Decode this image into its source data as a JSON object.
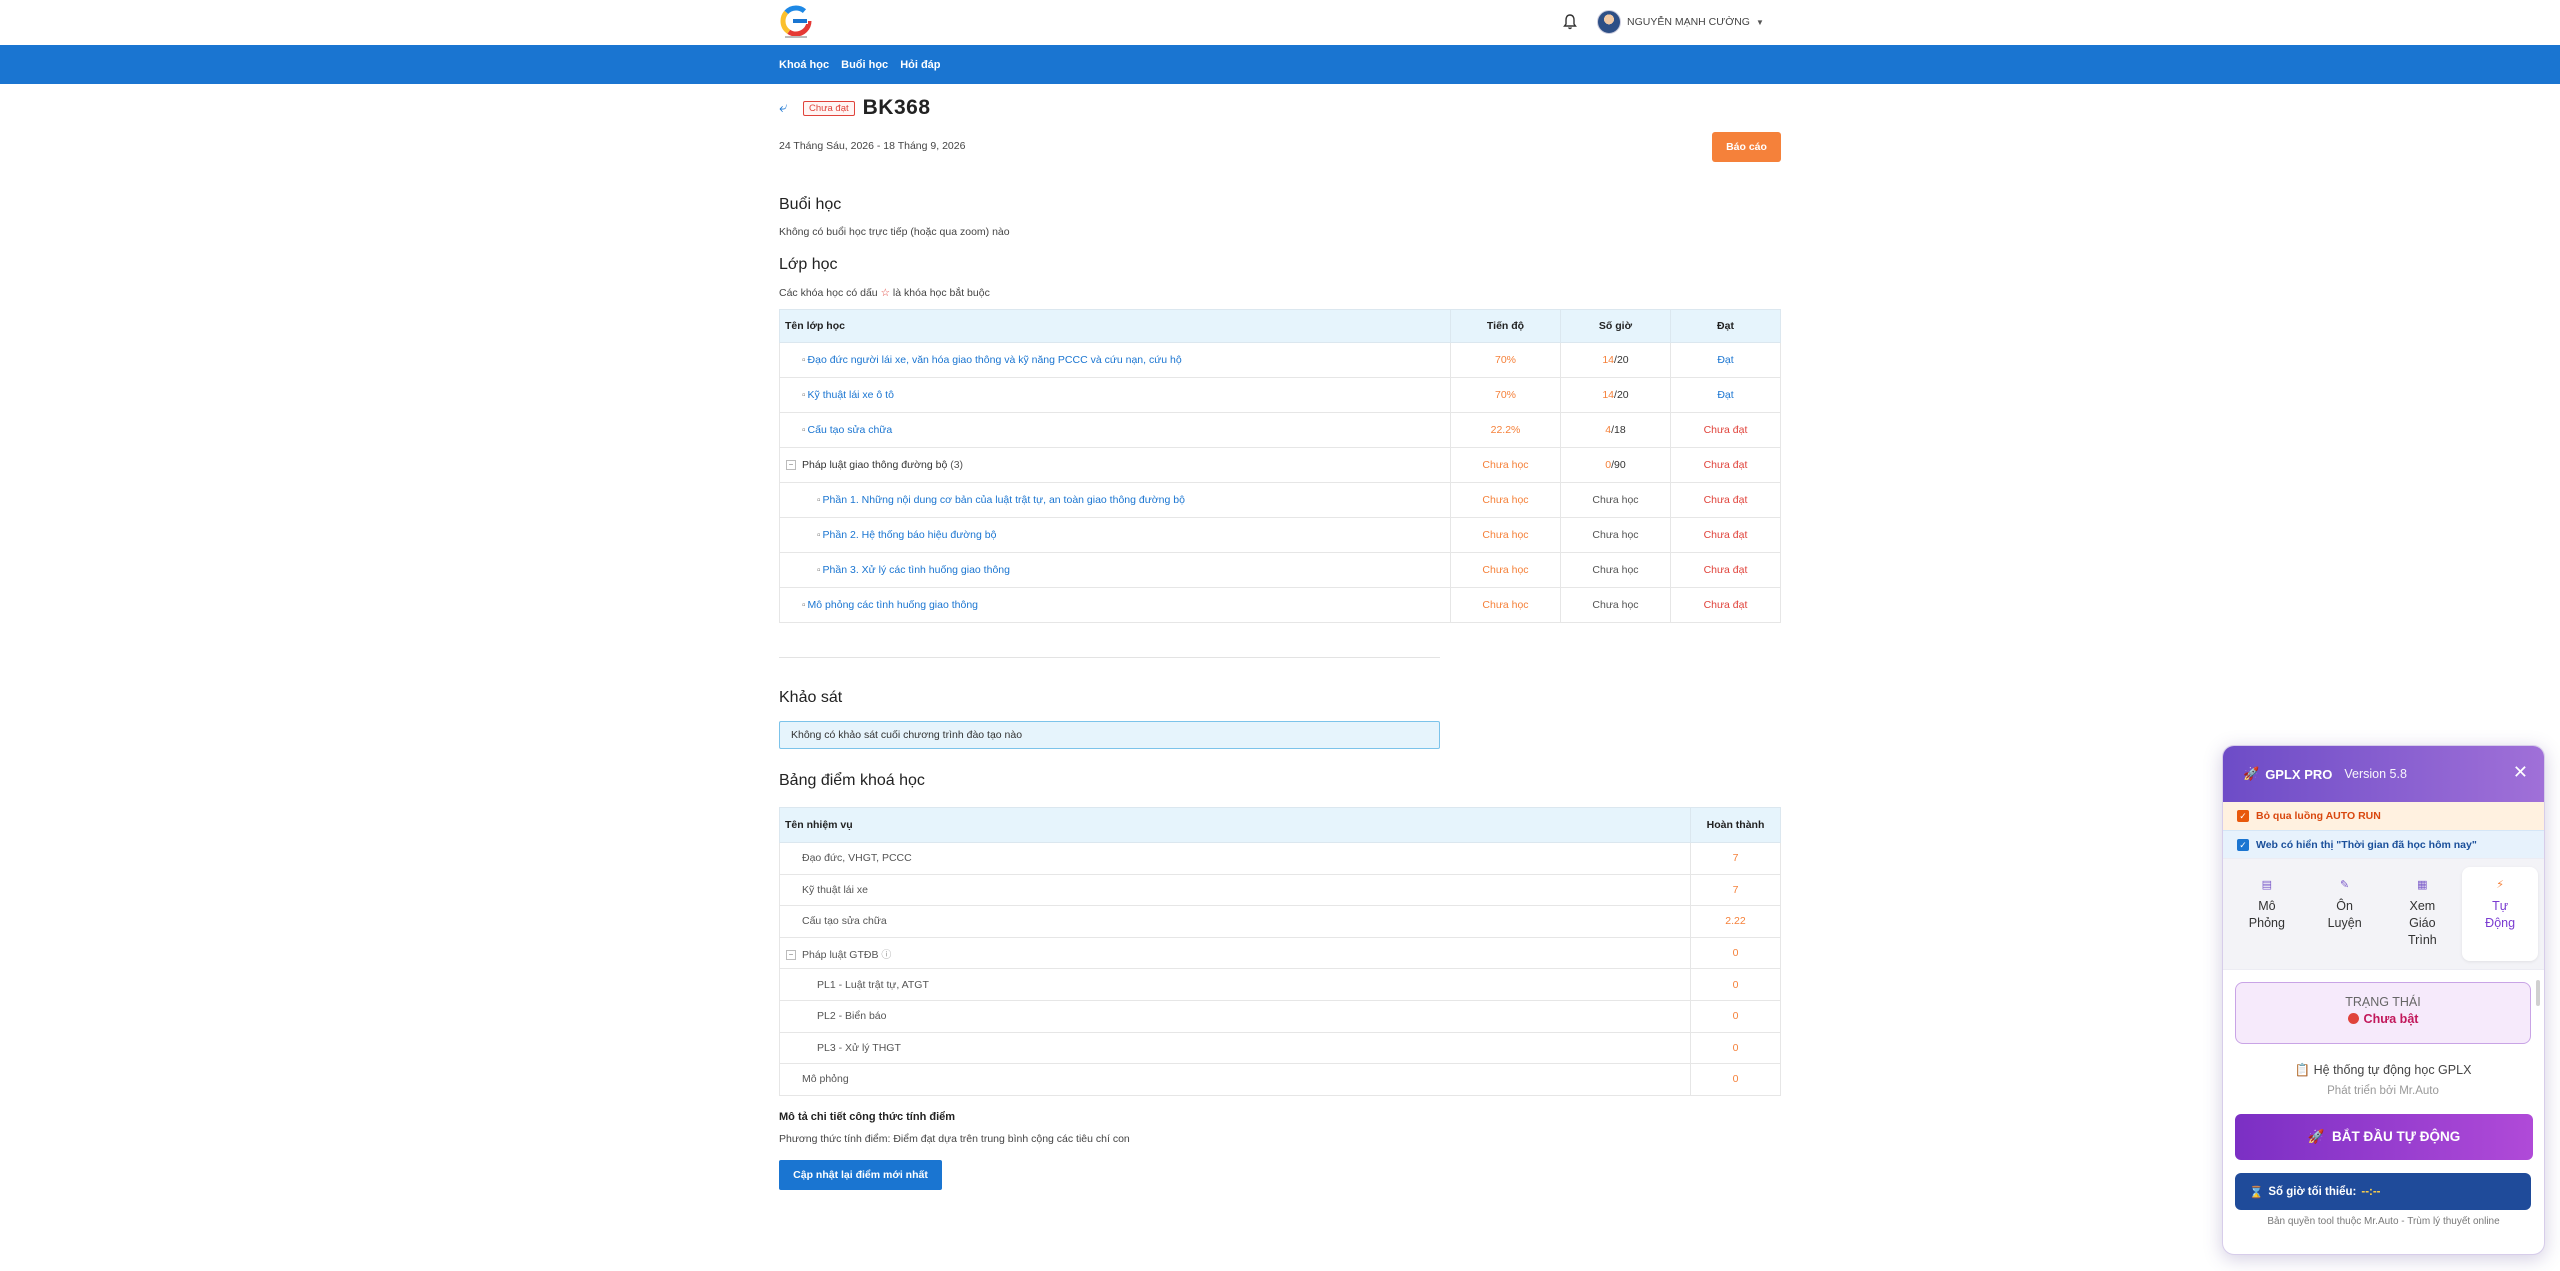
{
  "header": {
    "user_name": "NGUYỄN MẠNH CƯỜNG",
    "nav": [
      "Khoá học",
      "Buổi học",
      "Hỏi đáp"
    ]
  },
  "course": {
    "status_tag": "Chưa đạt",
    "title": "BK368",
    "date_range": "24 Tháng Sáu, 2026 - 18 Tháng 9, 2026",
    "report_label": "Báo cáo"
  },
  "sessions": {
    "heading": "Buổi học",
    "empty_text": "Không có buổi học trực tiếp (hoặc qua zoom) nào"
  },
  "classes": {
    "heading": "Lớp học",
    "note_before": "Các khóa học có dấu",
    "note_star": "☆",
    "note_after": "là khóa học bắt buộc",
    "columns": [
      "Tên lớp học",
      "Tiến độ",
      "Số giờ",
      "Đạt"
    ],
    "rows": [
      {
        "name": "Đạo đức người lái xe, văn hóa giao thông và kỹ năng PCCC và cứu nạn, cứu hộ",
        "progress": "70%",
        "hours_done": "14",
        "hours_total": "/20",
        "pass": "Đạt"
      },
      {
        "name": "Kỹ thuật lái xe ô tô",
        "progress": "70%",
        "hours_done": "14",
        "hours_total": "/20",
        "pass": "Đạt"
      },
      {
        "name": "Cấu tạo sửa chữa",
        "progress": "22.2%",
        "hours_done": "4",
        "hours_total": "/18",
        "pass": "Chưa đạt"
      },
      {
        "name": "Pháp luật giao thông đường bộ",
        "count": "(3)",
        "progress": "Chưa học",
        "hours_done": "0",
        "hours_total": "/90",
        "pass": "Chưa đạt"
      },
      {
        "name": "Phần 1. Những nội dung cơ bản của luật trật tự, an toàn giao thông đường bộ",
        "progress": "Chưa học",
        "hours": "Chưa học",
        "pass": "Chưa đạt"
      },
      {
        "name": "Phần 2. Hệ thống báo hiệu đường bộ",
        "progress": "Chưa học",
        "hours": "Chưa học",
        "pass": "Chưa đạt"
      },
      {
        "name": "Phần 3. Xử lý các tình huống giao thông",
        "progress": "Chưa học",
        "hours": "Chưa học",
        "pass": "Chưa đạt"
      },
      {
        "name": "Mô phỏng các tình huống giao thông",
        "progress": "Chưa học",
        "hours": "Chưa học",
        "pass": "Chưa đạt"
      }
    ]
  },
  "survey": {
    "heading": "Khảo sát",
    "empty_text": "Không có khảo sát cuối chương trình đào tạo nào"
  },
  "grades": {
    "heading": "Bảng điểm khoá học",
    "columns": [
      "Tên nhiệm vụ",
      "Hoàn thành"
    ],
    "rows": [
      {
        "name": "Đạo đức, VHGT, PCCC",
        "value": "7"
      },
      {
        "name": "Kỹ thuật lái xe",
        "value": "7"
      },
      {
        "name": "Cấu tạo sửa chữa",
        "value": "2.22"
      },
      {
        "name": "Pháp luật GTĐB",
        "value": "0"
      },
      {
        "name": "PL1 - Luật trật tự, ATGT",
        "value": "0"
      },
      {
        "name": "PL2 - Biển báo",
        "value": "0"
      },
      {
        "name": "PL3 - Xử lý THGT",
        "value": "0"
      },
      {
        "name": "Mô phỏng",
        "value": "0"
      }
    ],
    "formula_title": "Mô tả chi tiết công thức tính điểm",
    "formula_desc": "Phương thức tính điểm: Điểm đạt dựa trên trung bình cộng các tiêu chí con",
    "update_label": "Cập nhật lại điểm mới nhất"
  },
  "extension": {
    "name": "GPLX PRO",
    "version": "Version 5.8",
    "option1": "Bỏ qua luồng AUTO RUN",
    "option2": "Web có hiển thị \"Thời gian đã học hôm nay\"",
    "tabs": [
      {
        "line1": "Mô",
        "line2": "Phỏng",
        "line3": ""
      },
      {
        "line1": "Ôn",
        "line2": "Luyện",
        "line3": ""
      },
      {
        "line1": "Xem",
        "line2": "Giáo",
        "line3": "Trình"
      },
      {
        "line1": "Tự",
        "line2": "Động",
        "line3": ""
      }
    ],
    "state_label": "TRẠNG THÁI",
    "state_value": "Chưa bật",
    "system_title": "Hệ thống tự động học GPLX",
    "system_sub": "Phát triển bởi Mr.Auto",
    "start_label": "BẮT ĐẦU TỰ ĐỘNG",
    "min_hours_label": "Số giờ tối thiểu:",
    "min_hours_value": "--:--",
    "copyright": "Bản quyền tool thuộc Mr.Auto - Trùm lý thuyết online"
  },
  "colors": {
    "primary": "#1a75d1",
    "accent_orange": "#f5813a",
    "fail_red": "#e0433b",
    "ext_purple": "#7b2fc4"
  }
}
